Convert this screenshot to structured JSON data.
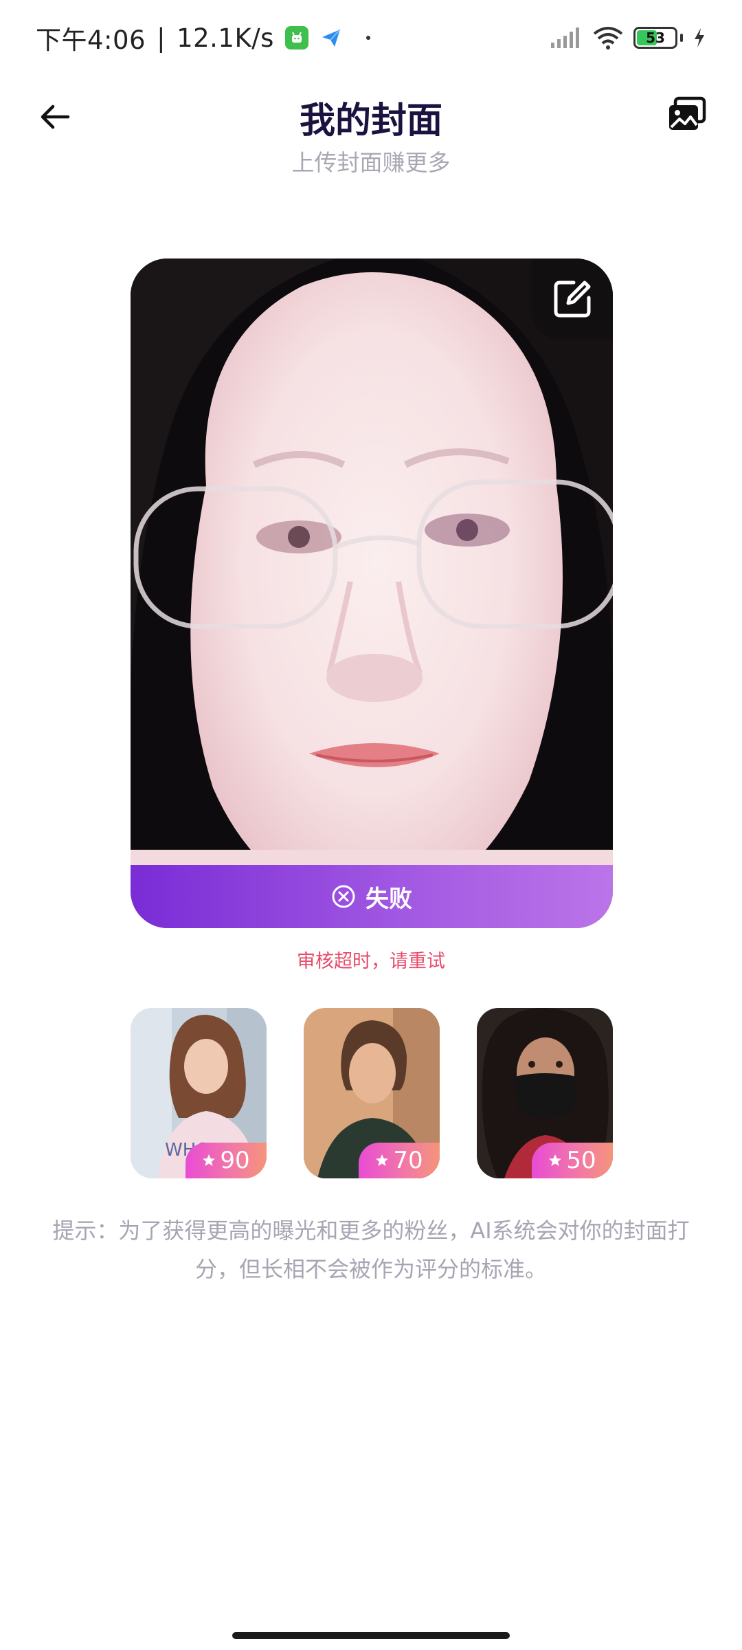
{
  "status_bar": {
    "time": "下午4:06",
    "network_speed": "12.1K/s",
    "battery": "53",
    "battery_level": 0.53
  },
  "header": {
    "title": "我的封面",
    "subtitle": "上传封面赚更多",
    "back_icon": "arrow-left-icon",
    "gallery_icon": "images-icon"
  },
  "cover": {
    "status_label": "失败",
    "error_message": "审核超时，请重试",
    "edit_icon": "edit-icon",
    "status_icon": "x-circle-icon"
  },
  "samples": [
    {
      "score": "90"
    },
    {
      "score": "70"
    },
    {
      "score": "50"
    }
  ],
  "tip": "提示：为了获得更高的曝光和更多的粉丝，AI系统会对你的封面打分，但长相不会被作为评分的标准。",
  "colors": {
    "title": "#1c1240",
    "accent_purple": "#7a2cd6",
    "error": "#e84a6a",
    "badge_pink": "#e84cd4"
  }
}
